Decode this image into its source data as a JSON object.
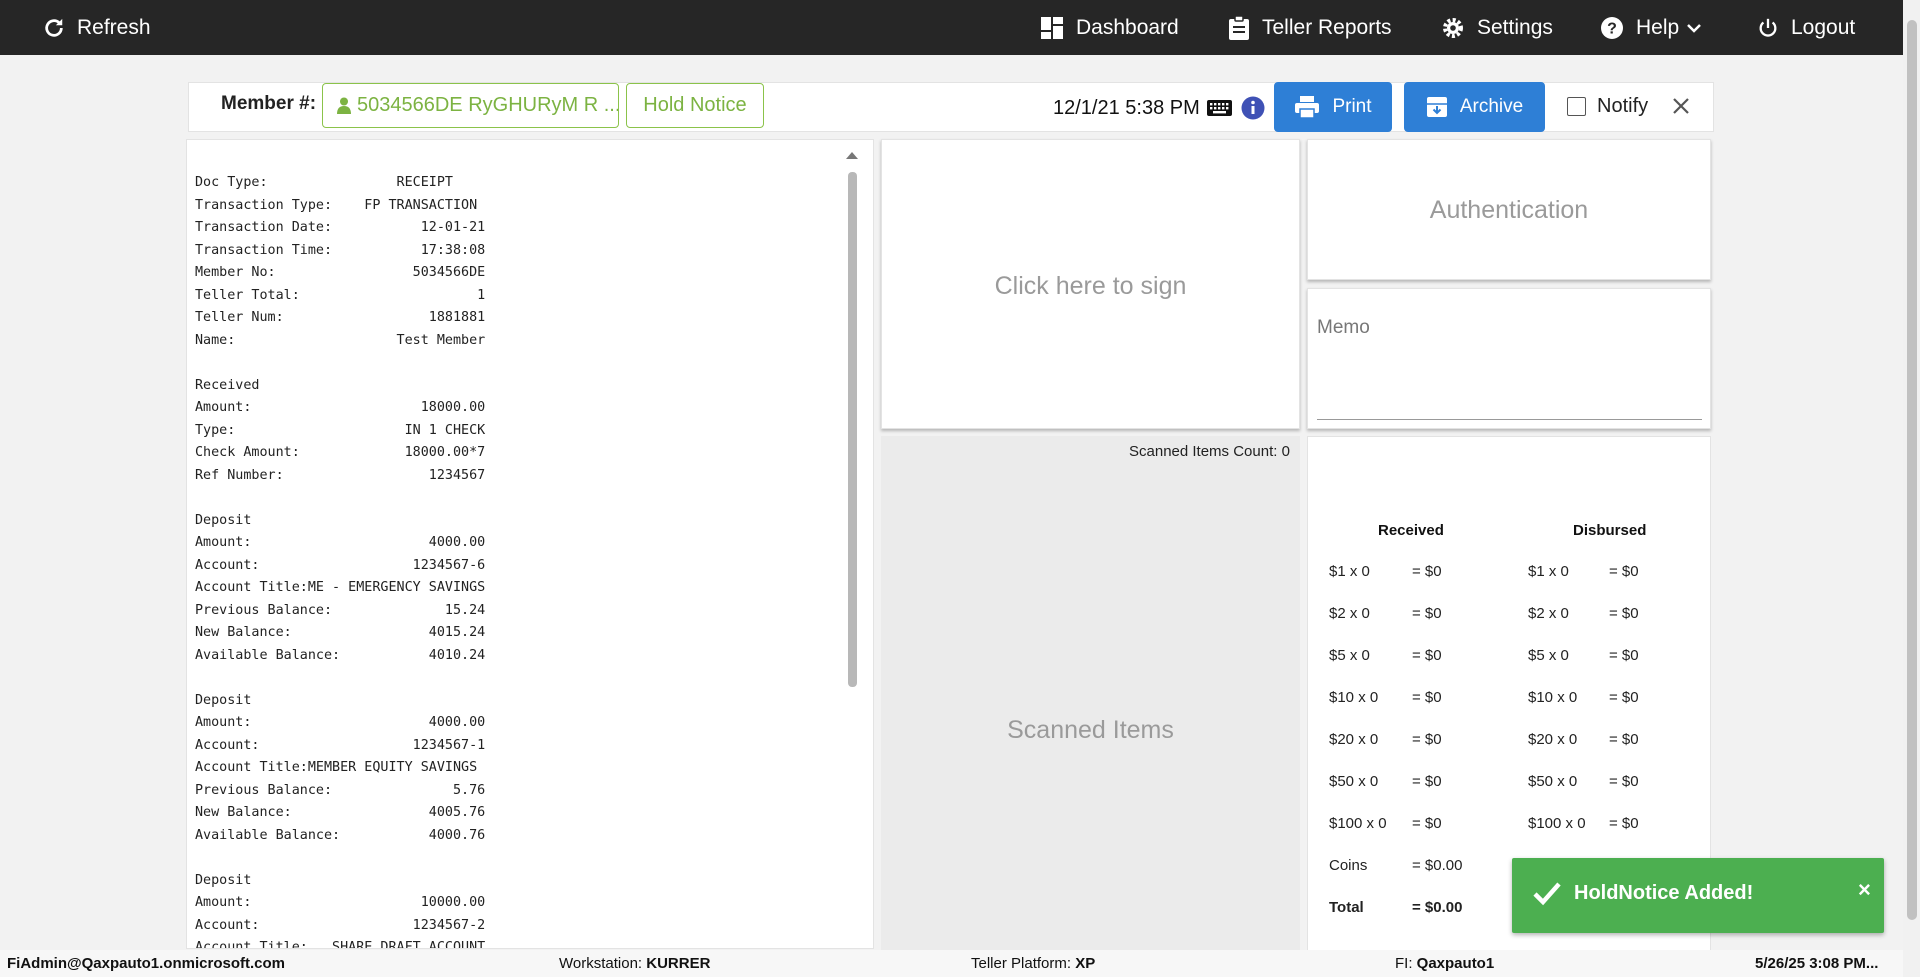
{
  "topbar": {
    "refresh": "Refresh",
    "dashboard": "Dashboard",
    "teller_reports": "Teller Reports",
    "settings": "Settings",
    "help": "Help",
    "logout": "Logout"
  },
  "member_bar": {
    "member_label": "Member #:",
    "member_value": "5034566DE RyGHURyM R ...",
    "hold_notice": "Hold Notice",
    "datetime": "12/1/21 5:38 PM",
    "print": "Print",
    "archive": "Archive",
    "notify": "Notify"
  },
  "receipt_text": "Doc Type:                RECEIPT\nTransaction Type:    FP TRANSACTION\nTransaction Date:           12-01-21\nTransaction Time:           17:38:08\nMember No:                 5034566DE\nTeller Total:                      1\nTeller Num:                  1881881\nName:                    Test Member\n\nReceived\nAmount:                     18000.00\nType:                     IN 1 CHECK\nCheck Amount:             18000.00*7\nRef Number:                  1234567\n\nDeposit\nAmount:                      4000.00\nAccount:                   1234567-6\nAccount Title:ME - EMERGENCY SAVINGS\nPrevious Balance:              15.24\nNew Balance:                 4015.24\nAvailable Balance:           4010.24\n\nDeposit\nAmount:                      4000.00\nAccount:                   1234567-1\nAccount Title:MEMBER EQUITY SAVINGS\nPrevious Balance:               5.76\nNew Balance:                 4005.76\nAvailable Balance:           4000.76\n\nDeposit\nAmount:                     10000.00\nAccount:                   1234567-2\nAccount Title:   SHARE DRAFT ACCOUNT",
  "panels": {
    "sign": "Click here to sign",
    "authentication": "Authentication",
    "memo": "Memo",
    "scanned_count": "Scanned Items Count: 0",
    "scanned_items": "Scanned Items"
  },
  "cash": {
    "received_header": "Received",
    "disbursed_header": "Disbursed",
    "received_rows": [
      {
        "label": "$1 x 0",
        "value": "= $0"
      },
      {
        "label": "$2 x 0",
        "value": "= $0"
      },
      {
        "label": "$5 x 0",
        "value": "= $0"
      },
      {
        "label": "$10 x 0",
        "value": "= $0"
      },
      {
        "label": "$20 x 0",
        "value": "= $0"
      },
      {
        "label": "$50 x 0",
        "value": "= $0"
      },
      {
        "label": "$100 x 0",
        "value": "= $0"
      },
      {
        "label": "Coins",
        "value": "= $0.00"
      },
      {
        "label": "Total",
        "value": "= $0.00"
      }
    ],
    "disbursed_rows": [
      {
        "label": "$1 x 0",
        "value": "= $0"
      },
      {
        "label": "$2 x 0",
        "value": "= $0"
      },
      {
        "label": "$5 x 0",
        "value": "= $0"
      },
      {
        "label": "$10 x 0",
        "value": "= $0"
      },
      {
        "label": "$20 x 0",
        "value": "= $0"
      },
      {
        "label": "$50 x 0",
        "value": "= $0"
      },
      {
        "label": "$100 x 0",
        "value": "= $0"
      }
    ]
  },
  "toast": {
    "message": "HoldNotice Added!",
    "close": "×"
  },
  "status_bar": {
    "user": "FiAdmin@Qaxpauto1.onmicrosoft.com",
    "workstation_label": "Workstation:",
    "workstation_value": "KURRER",
    "platform_label": "Teller Platform:",
    "platform_value": "XP",
    "fi_label": "FI:",
    "fi_value": "Qaxpauto1",
    "datetime": "5/26/25 3:08 PM..."
  },
  "colors": {
    "topbar_bg": "#262626",
    "primary_button": "#2e7fd6",
    "member_green": "#7cb342",
    "toast_green": "#4caf50"
  }
}
